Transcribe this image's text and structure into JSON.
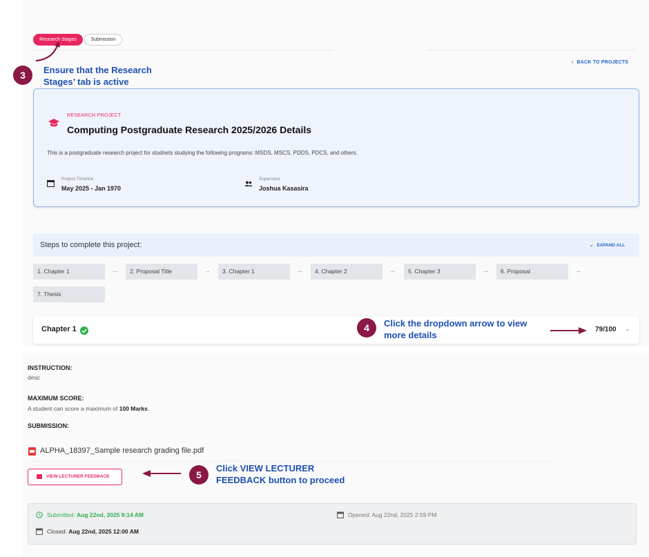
{
  "tabs": [
    "Research Stages",
    "Submission"
  ],
  "annotations": {
    "n3": {
      "num": "3",
      "text_line1": "Ensure that the Research",
      "text_line2": "Stages’ tab is active"
    },
    "n4": {
      "num": "4",
      "text_line1": "Click the dropdown arrow to view",
      "text_line2": "more details"
    },
    "n5": {
      "num": "5",
      "text_line1": "Click VIEW LECTURER",
      "text_line2": "FEEDBACK button  to proceed"
    }
  },
  "back_link": "BACK TO PROJECTS",
  "project": {
    "kicker": "RESEARCH PROJECT",
    "title": "Computing Postgraduate Research 2025/2026 Details",
    "description": "This is a postgraduate research project for studnets studying the following programs: MSDS, MSCS, PDDS, PDCS, and others.",
    "timeline_label": "Project Timeline",
    "timeline_value": "May 2025 - Jan 1970",
    "supervisor_label": "Supervisor",
    "supervisor_value": "Joshua Kasasira"
  },
  "steps": {
    "title": "Steps to complete this project:",
    "expand_all": "EXPAND ALL",
    "items": [
      "1. Chapter 1",
      "2. Proposal Title",
      "3. Chapter 1",
      "4. Chapter 2",
      "5. Chapter 3",
      "6. Proposal",
      "7. Thesis"
    ]
  },
  "chapter": {
    "title": "Chapter 1",
    "score": "79/100"
  },
  "details": {
    "instruction_label": "INSTRUCTION:",
    "instruction_value": "desc",
    "max_label": "MAXIMUM SCORE:",
    "max_prefix": "A student can score a maximum of ",
    "max_value": "100 Marks",
    "max_suffix": ".",
    "submission_label": "SUBMISSION:",
    "file_name": "ALPHA_18397_Sample research grading file.pdf",
    "feedback_button": "VIEW LECTURER FEEDBACK",
    "submitted_label": "Submitted: ",
    "submitted_value": "Aug 22nd, 2025 9:14 AM",
    "opened_text": "Opened: Aug 22nd, 2025 2:59 PM",
    "closed_label": "Closed: ",
    "closed_value": "Aug 22nd, 2025 12:00 AM"
  },
  "colors": {
    "accent": "#e8265e",
    "annotation": "#8b1745",
    "link": "#2563c9",
    "success": "#2eae4e"
  }
}
